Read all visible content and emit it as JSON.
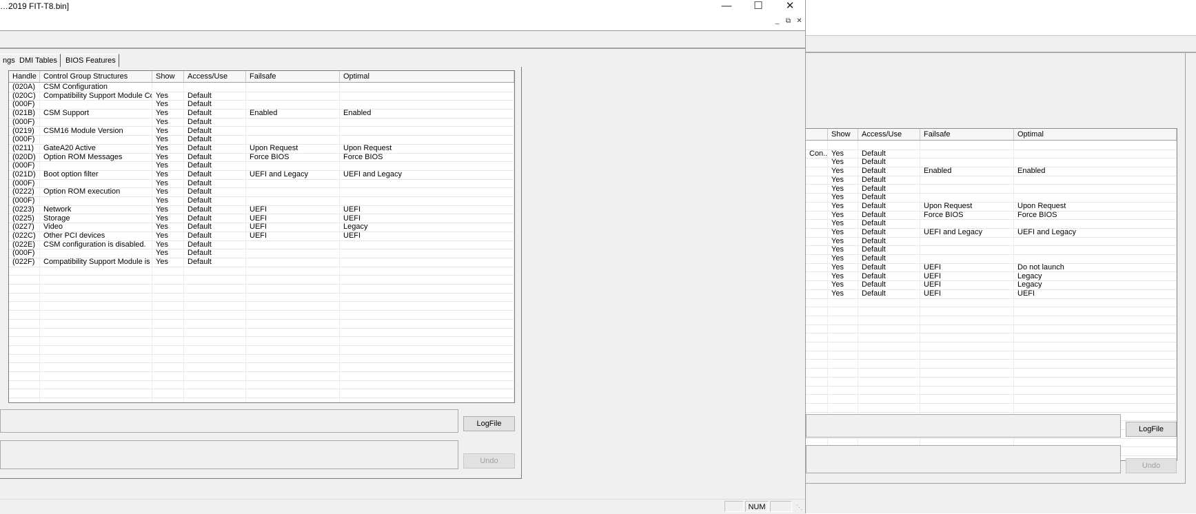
{
  "main": {
    "title": "…2019 FIT-T8.bin]",
    "tabs": [
      "ngs",
      "DMI Tables",
      "BIOS Features"
    ],
    "columns": [
      "Handle",
      "Control Group Structures",
      "Show",
      "Access/Use",
      "Failsafe",
      "Optimal"
    ],
    "rows": [
      [
        "(020A)",
        "CSM Configuration",
        "",
        "",
        "",
        ""
      ],
      [
        "(020C)",
        "Compatibility Support Module Con...",
        "Yes",
        "Default",
        "",
        ""
      ],
      [
        "(000F)",
        "",
        "Yes",
        "Default",
        "",
        ""
      ],
      [
        "(021B)",
        "CSM Support",
        "Yes",
        "Default",
        "Enabled",
        "Enabled"
      ],
      [
        "(000F)",
        "",
        "Yes",
        "Default",
        "",
        ""
      ],
      [
        "(0219)",
        "CSM16 Module Version",
        "Yes",
        "Default",
        "",
        ""
      ],
      [
        "(000F)",
        "",
        "Yes",
        "Default",
        "",
        ""
      ],
      [
        "(0211)",
        "GateA20 Active",
        "Yes",
        "Default",
        "Upon Request",
        "Upon Request"
      ],
      [
        "(020D)",
        "Option ROM Messages",
        "Yes",
        "Default",
        "Force BIOS",
        "Force BIOS"
      ],
      [
        "(000F)",
        "",
        "Yes",
        "Default",
        "",
        ""
      ],
      [
        "(021D)",
        "Boot option filter",
        "Yes",
        "Default",
        "UEFI and Legacy",
        "UEFI and Legacy"
      ],
      [
        "(000F)",
        "",
        "Yes",
        "Default",
        "",
        ""
      ],
      [
        "(0222)",
        "Option ROM execution",
        "Yes",
        "Default",
        "",
        ""
      ],
      [
        "(000F)",
        "",
        "Yes",
        "Default",
        "",
        ""
      ],
      [
        "(0223)",
        "Network",
        "Yes",
        "Default",
        "UEFI",
        "UEFI"
      ],
      [
        "(0225)",
        "Storage",
        "Yes",
        "Default",
        "UEFI",
        "UEFI"
      ],
      [
        "(0227)",
        "Video",
        "Yes",
        "Default",
        "UEFI",
        "Legacy"
      ],
      [
        "(022C)",
        "Other PCI devices",
        "Yes",
        "Default",
        "UEFI",
        "UEFI"
      ],
      [
        "(022E)",
        "CSM configuration is disabled.",
        "Yes",
        "Default",
        "",
        ""
      ],
      [
        "(000F)",
        "",
        "Yes",
        "Default",
        "",
        ""
      ],
      [
        "(022F)",
        "Compatibility Support Module is n...",
        "Yes",
        "Default",
        "",
        ""
      ]
    ],
    "logfile_label": "LogFile",
    "undo_label": "Undo",
    "status_num": "NUM"
  },
  "second": {
    "columns": [
      "",
      "Show",
      "Access/Use",
      "Failsafe",
      "Optimal"
    ],
    "rows": [
      [
        "",
        "",
        "",
        "",
        ""
      ],
      [
        "Con...",
        "Yes",
        "Default",
        "",
        ""
      ],
      [
        "",
        "Yes",
        "Default",
        "",
        ""
      ],
      [
        "",
        "Yes",
        "Default",
        "Enabled",
        "Enabled"
      ],
      [
        "",
        "Yes",
        "Default",
        "",
        ""
      ],
      [
        "",
        "Yes",
        "Default",
        "",
        ""
      ],
      [
        "",
        "Yes",
        "Default",
        "",
        ""
      ],
      [
        "",
        "Yes",
        "Default",
        "Upon Request",
        "Upon Request"
      ],
      [
        "",
        "Yes",
        "Default",
        "Force BIOS",
        "Force BIOS"
      ],
      [
        "",
        "Yes",
        "Default",
        "",
        ""
      ],
      [
        "",
        "Yes",
        "Default",
        "UEFI and Legacy",
        "UEFI and Legacy"
      ],
      [
        "",
        "Yes",
        "Default",
        "",
        ""
      ],
      [
        "",
        "Yes",
        "Default",
        "",
        ""
      ],
      [
        "",
        "Yes",
        "Default",
        "",
        ""
      ],
      [
        "",
        "Yes",
        "Default",
        "UEFI",
        "Do not launch"
      ],
      [
        "",
        "Yes",
        "Default",
        "UEFI",
        "Legacy"
      ],
      [
        "",
        "Yes",
        "Default",
        "UEFI",
        "Legacy"
      ],
      [
        "",
        "Yes",
        "Default",
        "UEFI",
        "UEFI"
      ]
    ],
    "logfile_label": "LogFile",
    "undo_label": "Undo"
  }
}
